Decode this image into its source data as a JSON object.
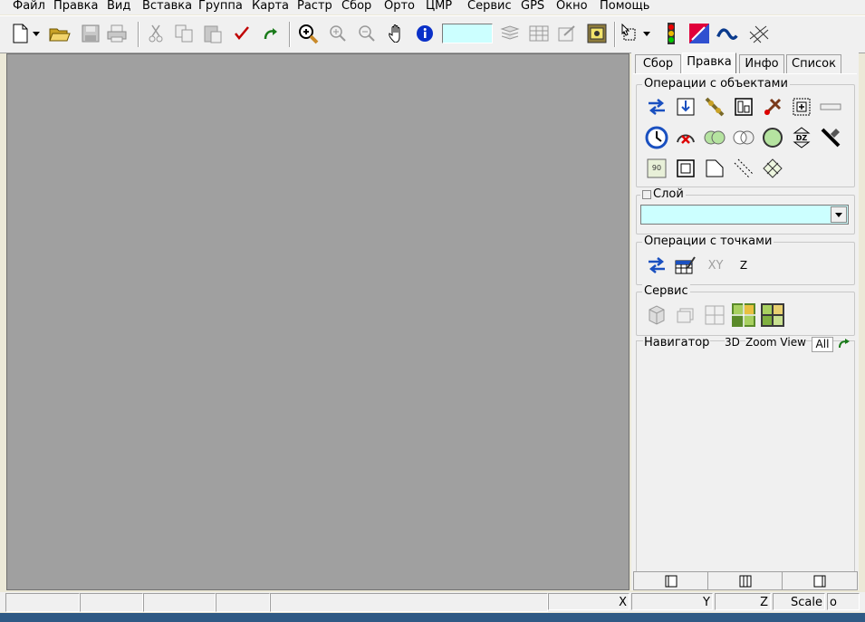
{
  "menu": [
    "Файл",
    "Правка",
    "Вид",
    "Вставка",
    "Группа",
    "Карта",
    "Растр",
    "Сбор",
    "Орто",
    "ЦМР",
    "Сервис",
    "GPS",
    "Окно",
    "Помощь"
  ],
  "toolbar": {
    "field_value": "",
    "icons": [
      "new-document",
      "open-folder",
      "save",
      "print",
      "cut",
      "copy",
      "paste",
      "check",
      "redo",
      "zoom-select",
      "zoom-in",
      "zoom-out",
      "pan-hand",
      "info",
      "layers",
      "table",
      "properties",
      "tools",
      "select-object",
      "traffic-light",
      "raster-tool",
      "curve-tool",
      "grid-tool"
    ]
  },
  "panel": {
    "tabs": [
      "Сбор",
      "Правка",
      "Инфо",
      "Список"
    ],
    "active_tab": "Правка",
    "groups": {
      "objects": "Операции с объектами",
      "layer": "Слой",
      "points": "Операции с точками",
      "service": "Сервис",
      "navigator": "Навигатор"
    },
    "layer_value": "",
    "points_labels": {
      "xy": "XY",
      "z": "Z"
    },
    "navigator": {
      "mode_3d": "3D",
      "zoom_view": "Zoom View",
      "all": "All"
    }
  },
  "status": {
    "x": "X",
    "y": "Y",
    "z": "Z",
    "scale": "Scale",
    "info": "o"
  },
  "colors": {
    "canvas": "#a0a0a0",
    "field": "#ccffff",
    "panel": "#f0f0f0"
  }
}
